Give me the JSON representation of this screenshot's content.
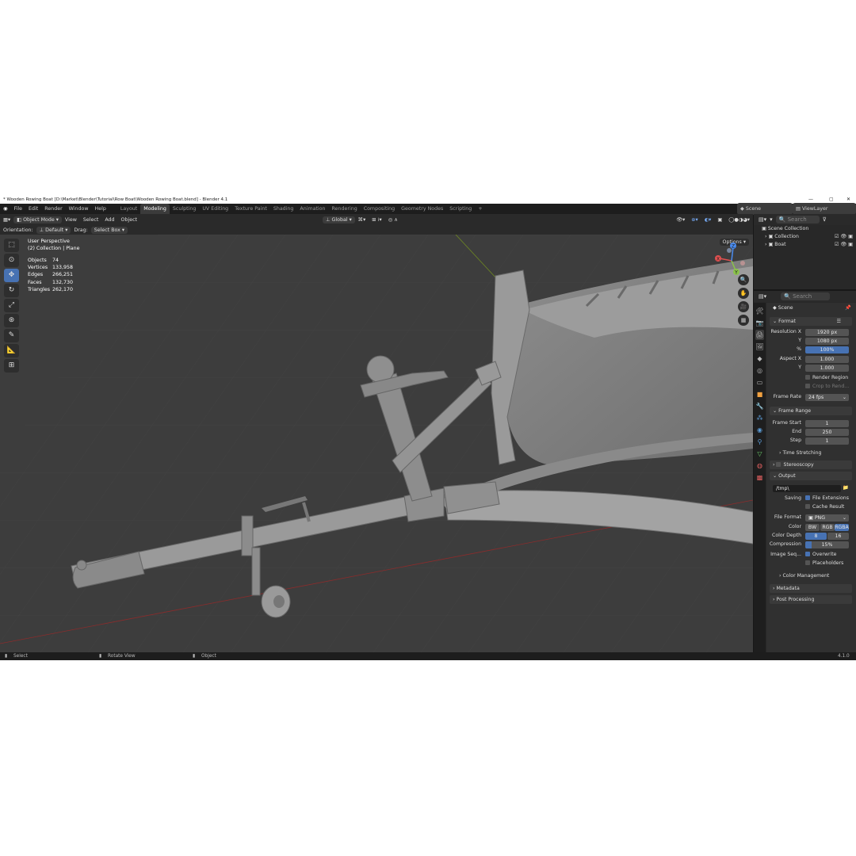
{
  "window": {
    "title": "* Wooden Rowing Boat [D:\\Market\\Blender\\Tutorial\\Row Boat\\Wooden Rowing Boat.blend] - Blender 4.1"
  },
  "menu": [
    "File",
    "Edit",
    "Render",
    "Window",
    "Help"
  ],
  "workspaces": [
    {
      "label": "Layout",
      "active": false
    },
    {
      "label": "Modeling",
      "active": true
    },
    {
      "label": "Sculpting",
      "active": false
    },
    {
      "label": "UV Editing",
      "active": false
    },
    {
      "label": "Texture Paint",
      "active": false
    },
    {
      "label": "Shading",
      "active": false
    },
    {
      "label": "Animation",
      "active": false
    },
    {
      "label": "Rendering",
      "active": false
    },
    {
      "label": "Compositing",
      "active": false
    },
    {
      "label": "Geometry Nodes",
      "active": false
    },
    {
      "label": "Scripting",
      "active": false
    }
  ],
  "add_workspace": "+",
  "scene_selector": "Scene",
  "viewlayer_selector": "ViewLayer",
  "header": {
    "mode": "Object Mode",
    "menus": [
      "View",
      "Select",
      "Add",
      "Object"
    ],
    "transform_orientation": "Global",
    "orientation_label": "Orientation:",
    "orientation_value": "Default",
    "drag_label": "Drag:",
    "drag_value": "Select Box",
    "options": "Options"
  },
  "viewport": {
    "perspective": "User Perspective",
    "collection": "(2) Collection | Plane",
    "stats": [
      {
        "label": "Objects",
        "value": "74"
      },
      {
        "label": "Vertices",
        "value": "133,958"
      },
      {
        "label": "Edges",
        "value": "266,251"
      },
      {
        "label": "Faces",
        "value": "132,730"
      },
      {
        "label": "Triangles",
        "value": "262,170"
      }
    ],
    "gizmo": {
      "x": "X",
      "y": "Y",
      "z": "Z"
    }
  },
  "outliner": {
    "search_placeholder": "Search",
    "root": "Scene Collection",
    "items": [
      "Collection",
      "Boat"
    ]
  },
  "properties": {
    "search_placeholder": "Search",
    "context": "Scene",
    "format": {
      "title": "Format",
      "resolution_x_label": "Resolution X",
      "resolution_x": "1920 px",
      "y_label": "Y",
      "resolution_y": "1080 px",
      "pct_label": "%",
      "percent": "100%",
      "aspect_x_label": "Aspect X",
      "aspect_x": "1.000",
      "aspect_y": "1.000",
      "render_region": "Render Region",
      "crop": "Crop to Rend...",
      "frame_rate_label": "Frame Rate",
      "frame_rate": "24 fps"
    },
    "frame_range": {
      "title": "Frame Range",
      "start_label": "Frame Start",
      "start": "1",
      "end_label": "End",
      "end": "250",
      "step_label": "Step",
      "step": "1"
    },
    "time_stretching": "Time Stretching",
    "stereoscopy": "Stereoscopy",
    "output": {
      "title": "Output",
      "path": "/tmp\\",
      "saving_label": "Saving",
      "file_extensions": "File Extensions",
      "cache_result": "Cache Result",
      "file_format_label": "File Format",
      "file_format": "PNG",
      "color_label": "Color",
      "color_options": [
        "BW",
        "RGB",
        "RGBA"
      ],
      "color_depth_label": "Color Depth",
      "depth_options": [
        "8",
        "16"
      ],
      "compression_label": "Compression",
      "compression": "15%",
      "compression_fraction": 0.15,
      "image_seq_label": "Image Seq...",
      "overwrite": "Overwrite",
      "placeholders": "Placeholders",
      "color_management": "Color Management"
    },
    "metadata": "Metadata",
    "post_processing": "Post Processing"
  },
  "statusbar": {
    "select": "Select",
    "rotate": "Rotate View",
    "object": "Object",
    "version": "4.1.0"
  }
}
